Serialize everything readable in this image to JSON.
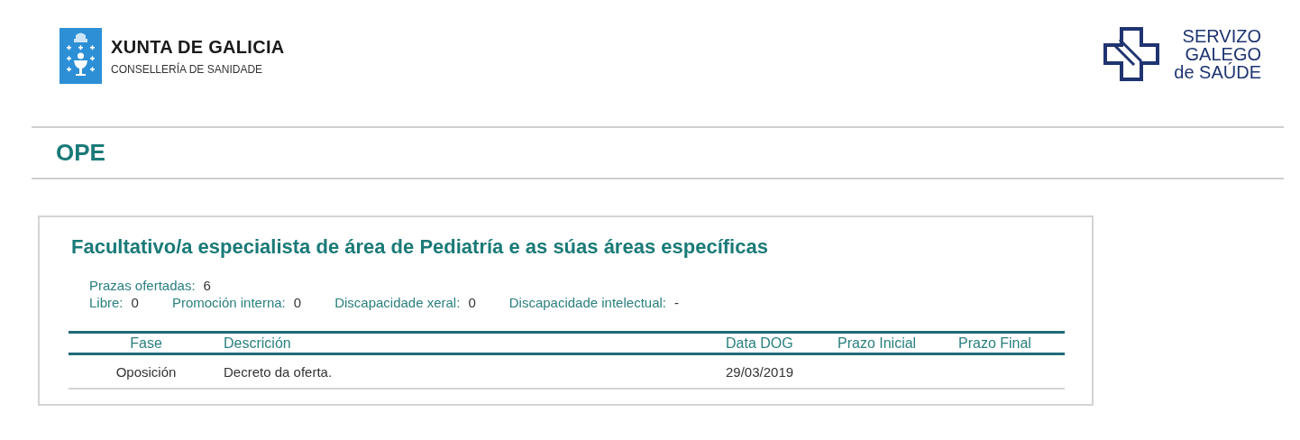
{
  "header": {
    "left_logo": {
      "title": "XUNTA DE GALICIA",
      "subtitle": "CONSELLERÍA DE SANIDADE"
    },
    "right_logo": {
      "lines": [
        "SERVIZO",
        "GALEGO",
        "de SAÚDE"
      ]
    }
  },
  "page_title": "OPE",
  "card": {
    "title": "Facultativo/a especialista de área de Pediatría e as súas áreas específicas",
    "offered": {
      "label": "Prazas ofertadas:",
      "value": "6"
    },
    "breakdown": [
      {
        "label": "Libre:",
        "value": "0"
      },
      {
        "label": "Promoción interna:",
        "value": "0"
      },
      {
        "label": "Discapacidade xeral:",
        "value": "0"
      },
      {
        "label": "Discapacidade intelectual:",
        "value": "-"
      }
    ],
    "table": {
      "columns": [
        "Fase",
        "Descrición",
        "Data DOG",
        "Prazo Inicial",
        "Prazo Final"
      ],
      "rows": [
        [
          "Oposición",
          "Decreto da oferta.",
          "29/03/2019",
          "",
          ""
        ]
      ]
    }
  }
}
